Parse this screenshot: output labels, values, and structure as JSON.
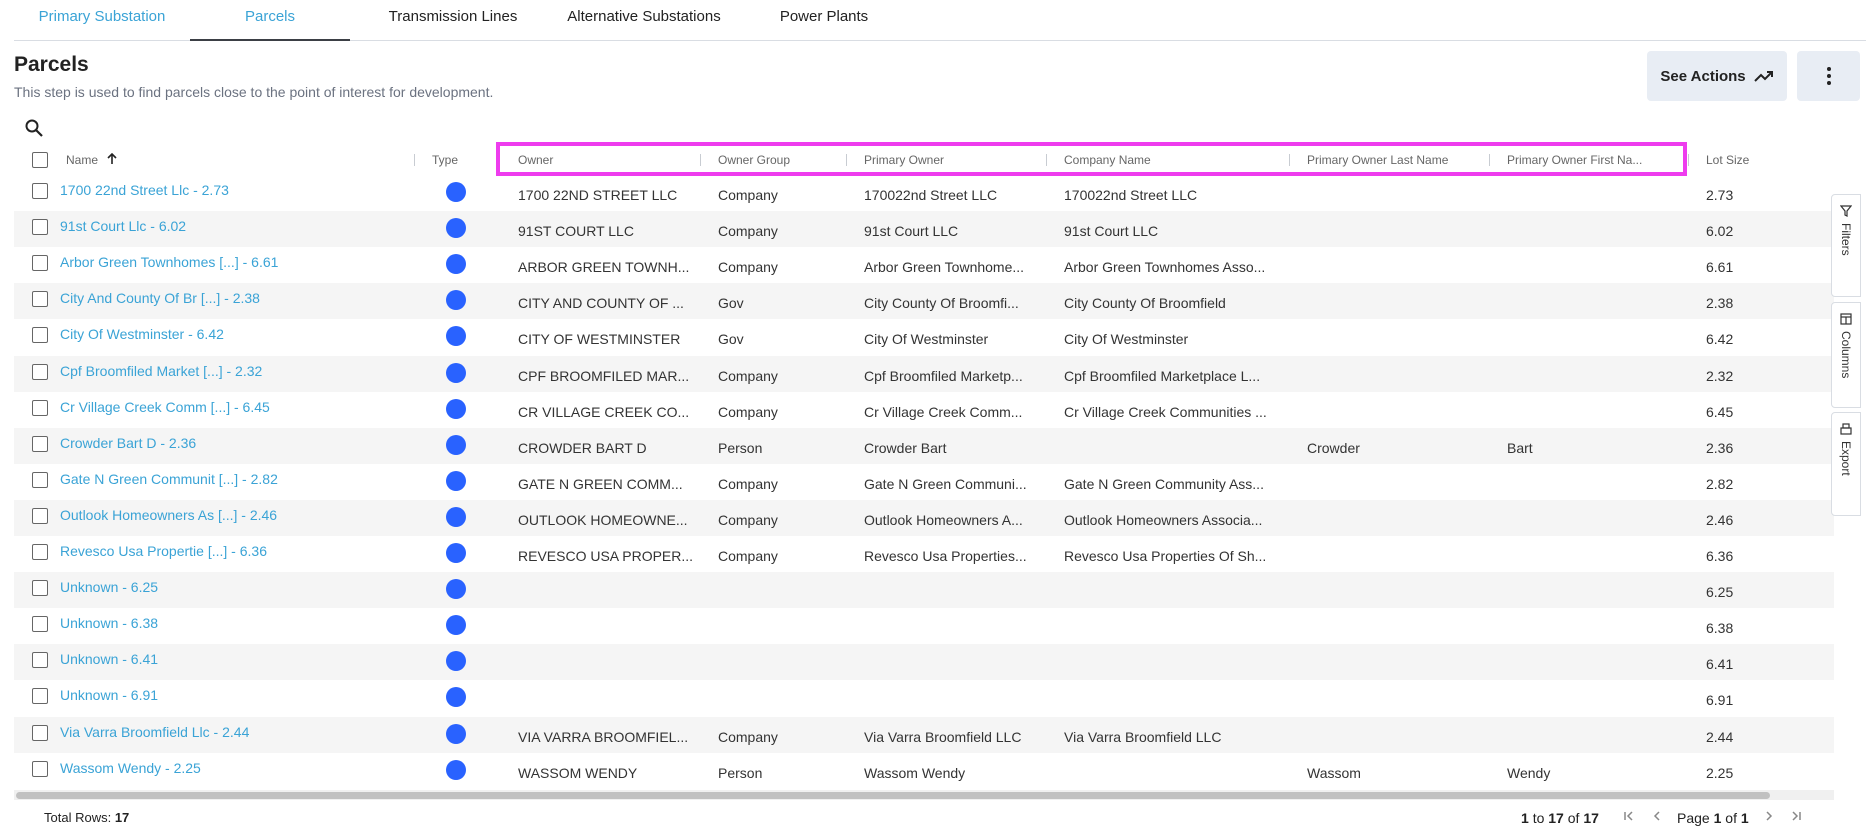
{
  "tabs": [
    {
      "label": "Primary Substation"
    },
    {
      "label": "Parcels"
    },
    {
      "label": "Transmission Lines"
    },
    {
      "label": "Alternative Substations"
    },
    {
      "label": "Power Plants"
    }
  ],
  "header": {
    "title": "Parcels",
    "description": "This step is used to find parcels close to the point of interest for development.",
    "see_actions_label": "See Actions"
  },
  "columns": {
    "name": "Name",
    "type": "Type",
    "owner": "Owner",
    "owner_group": "Owner Group",
    "primary_owner": "Primary Owner",
    "company_name": "Company Name",
    "last_name": "Primary Owner Last Name",
    "first_name": "Primary Owner First Na...",
    "lot_size": "Lot Size"
  },
  "rows": [
    {
      "name": "1700 22nd Street Llc - 2.73",
      "owner": "1700 22ND STREET LLC",
      "owner_group": "Company",
      "primary_owner": "170022nd Street LLC",
      "company_name": "170022nd Street LLC",
      "last_name": "",
      "first_name": "",
      "lot_size": "2.73"
    },
    {
      "name": "91st Court Llc - 6.02",
      "owner": "91ST COURT LLC",
      "owner_group": "Company",
      "primary_owner": "91st Court LLC",
      "company_name": "91st Court LLC",
      "last_name": "",
      "first_name": "",
      "lot_size": "6.02"
    },
    {
      "name": "Arbor Green Townhomes [...] - 6.61",
      "owner": "ARBOR GREEN TOWNH...",
      "owner_group": "Company",
      "primary_owner": "Arbor Green Townhome...",
      "company_name": "Arbor Green Townhomes Asso...",
      "last_name": "",
      "first_name": "",
      "lot_size": "6.61"
    },
    {
      "name": "City And County Of Br [...] - 2.38",
      "owner": "CITY AND COUNTY OF ...",
      "owner_group": "Gov",
      "primary_owner": "City County Of Broomfi...",
      "company_name": "City County Of Broomfield",
      "last_name": "",
      "first_name": "",
      "lot_size": "2.38"
    },
    {
      "name": "City Of Westminster - 6.42",
      "owner": "CITY OF WESTMINSTER",
      "owner_group": "Gov",
      "primary_owner": "City Of Westminster",
      "company_name": "City Of Westminster",
      "last_name": "",
      "first_name": "",
      "lot_size": "6.42"
    },
    {
      "name": "Cpf Broomfiled Market [...] - 2.32",
      "owner": "CPF BROOMFILED MAR...",
      "owner_group": "Company",
      "primary_owner": "Cpf Broomfiled Marketp...",
      "company_name": "Cpf Broomfiled Marketplace L...",
      "last_name": "",
      "first_name": "",
      "lot_size": "2.32"
    },
    {
      "name": "Cr Village Creek Comm [...] - 6.45",
      "owner": "CR VILLAGE CREEK CO...",
      "owner_group": "Company",
      "primary_owner": "Cr Village Creek Comm...",
      "company_name": "Cr Village Creek Communities ...",
      "last_name": "",
      "first_name": "",
      "lot_size": "6.45"
    },
    {
      "name": "Crowder Bart D - 2.36",
      "owner": "CROWDER BART D",
      "owner_group": "Person",
      "primary_owner": "Crowder Bart",
      "company_name": "",
      "last_name": "Crowder",
      "first_name": "Bart",
      "lot_size": "2.36"
    },
    {
      "name": "Gate N Green Communit [...] - 2.82",
      "owner": "GATE N GREEN COMM...",
      "owner_group": "Company",
      "primary_owner": "Gate N Green Communi...",
      "company_name": "Gate N Green Community Ass...",
      "last_name": "",
      "first_name": "",
      "lot_size": "2.82"
    },
    {
      "name": "Outlook Homeowners As [...] - 2.46",
      "owner": "OUTLOOK HOMEOWNE...",
      "owner_group": "Company",
      "primary_owner": "Outlook Homeowners A...",
      "company_name": "Outlook Homeowners Associa...",
      "last_name": "",
      "first_name": "",
      "lot_size": "2.46"
    },
    {
      "name": "Revesco Usa Propertie [...] - 6.36",
      "owner": "REVESCO USA PROPER...",
      "owner_group": "Company",
      "primary_owner": "Revesco Usa Properties...",
      "company_name": "Revesco Usa Properties Of Sh...",
      "last_name": "",
      "first_name": "",
      "lot_size": "6.36"
    },
    {
      "name": "Unknown - 6.25",
      "owner": "",
      "owner_group": "",
      "primary_owner": "",
      "company_name": "",
      "last_name": "",
      "first_name": "",
      "lot_size": "6.25"
    },
    {
      "name": "Unknown - 6.38",
      "owner": "",
      "owner_group": "",
      "primary_owner": "",
      "company_name": "",
      "last_name": "",
      "first_name": "",
      "lot_size": "6.38"
    },
    {
      "name": "Unknown - 6.41",
      "owner": "",
      "owner_group": "",
      "primary_owner": "",
      "company_name": "",
      "last_name": "",
      "first_name": "",
      "lot_size": "6.41"
    },
    {
      "name": "Unknown - 6.91",
      "owner": "",
      "owner_group": "",
      "primary_owner": "",
      "company_name": "",
      "last_name": "",
      "first_name": "",
      "lot_size": "6.91"
    },
    {
      "name": "Via Varra Broomfield Llc - 2.44",
      "owner": "VIA VARRA BROOMFIEL...",
      "owner_group": "Company",
      "primary_owner": "Via Varra Broomfield LLC",
      "company_name": "Via Varra Broomfield LLC",
      "last_name": "",
      "first_name": "",
      "lot_size": "2.44"
    },
    {
      "name": "Wassom Wendy - 2.25",
      "owner": "WASSOM WENDY",
      "owner_group": "Person",
      "primary_owner": "Wassom Wendy",
      "company_name": "",
      "last_name": "Wassom",
      "first_name": "Wendy",
      "lot_size": "2.25"
    }
  ],
  "footer": {
    "total_label": "Total Rows:",
    "total_value": "17",
    "range_from": "1",
    "range_to_word": "to",
    "range_to": "17",
    "range_of_word": "of",
    "range_total": "17",
    "page_word": "Page",
    "page_current": "1",
    "page_of_word": "of",
    "page_total": "1"
  },
  "side_panel": {
    "filters_label": "Filters",
    "columns_label": "Columns",
    "export_label": "Export"
  },
  "colors": {
    "link": "#3aa3d6",
    "type_dot": "#2962ff",
    "highlight": "#ee3cee",
    "button_bg": "#e8edf4"
  }
}
